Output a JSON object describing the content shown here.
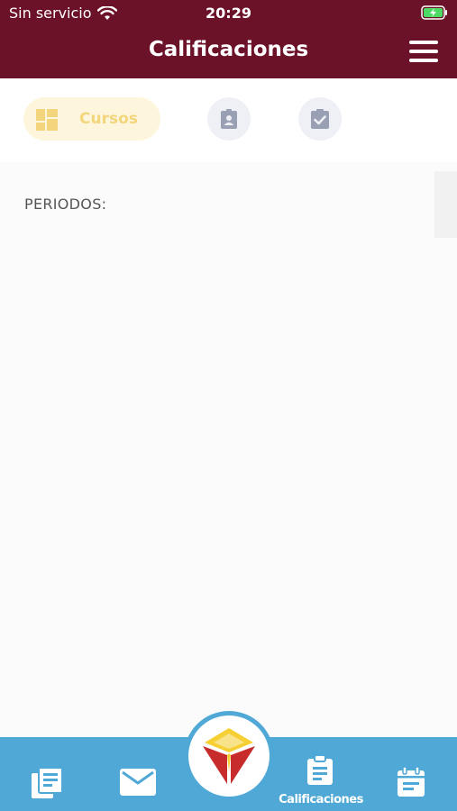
{
  "status_bar": {
    "carrier": "Sin servicio",
    "time": "20:29",
    "wifi_icon": "wifi-icon",
    "battery_icon": "battery-charging-icon"
  },
  "header": {
    "title": "Calificaciones",
    "menu_icon": "hamburger-menu-icon"
  },
  "tabs": {
    "active": {
      "label": "Cursos",
      "icon": "grid-icon"
    },
    "items": [
      {
        "icon": "badge-icon"
      },
      {
        "icon": "clipboard-check-icon"
      }
    ]
  },
  "content": {
    "periods_label": "PERIODOS:"
  },
  "bottom_nav": {
    "items": [
      {
        "icon": "news-icon"
      },
      {
        "icon": "mail-icon"
      },
      {
        "icon": "logo-icon"
      },
      {
        "icon": "clipboard-icon",
        "label": "Calificaciones"
      },
      {
        "icon": "calendar-icon"
      }
    ]
  },
  "colors": {
    "header": "#6b1128",
    "accent_yellow": "#f3d57b",
    "bottom_bar": "#4fa8d5",
    "logo_red": "#c72b2b",
    "logo_yellow": "#f6cf32"
  }
}
